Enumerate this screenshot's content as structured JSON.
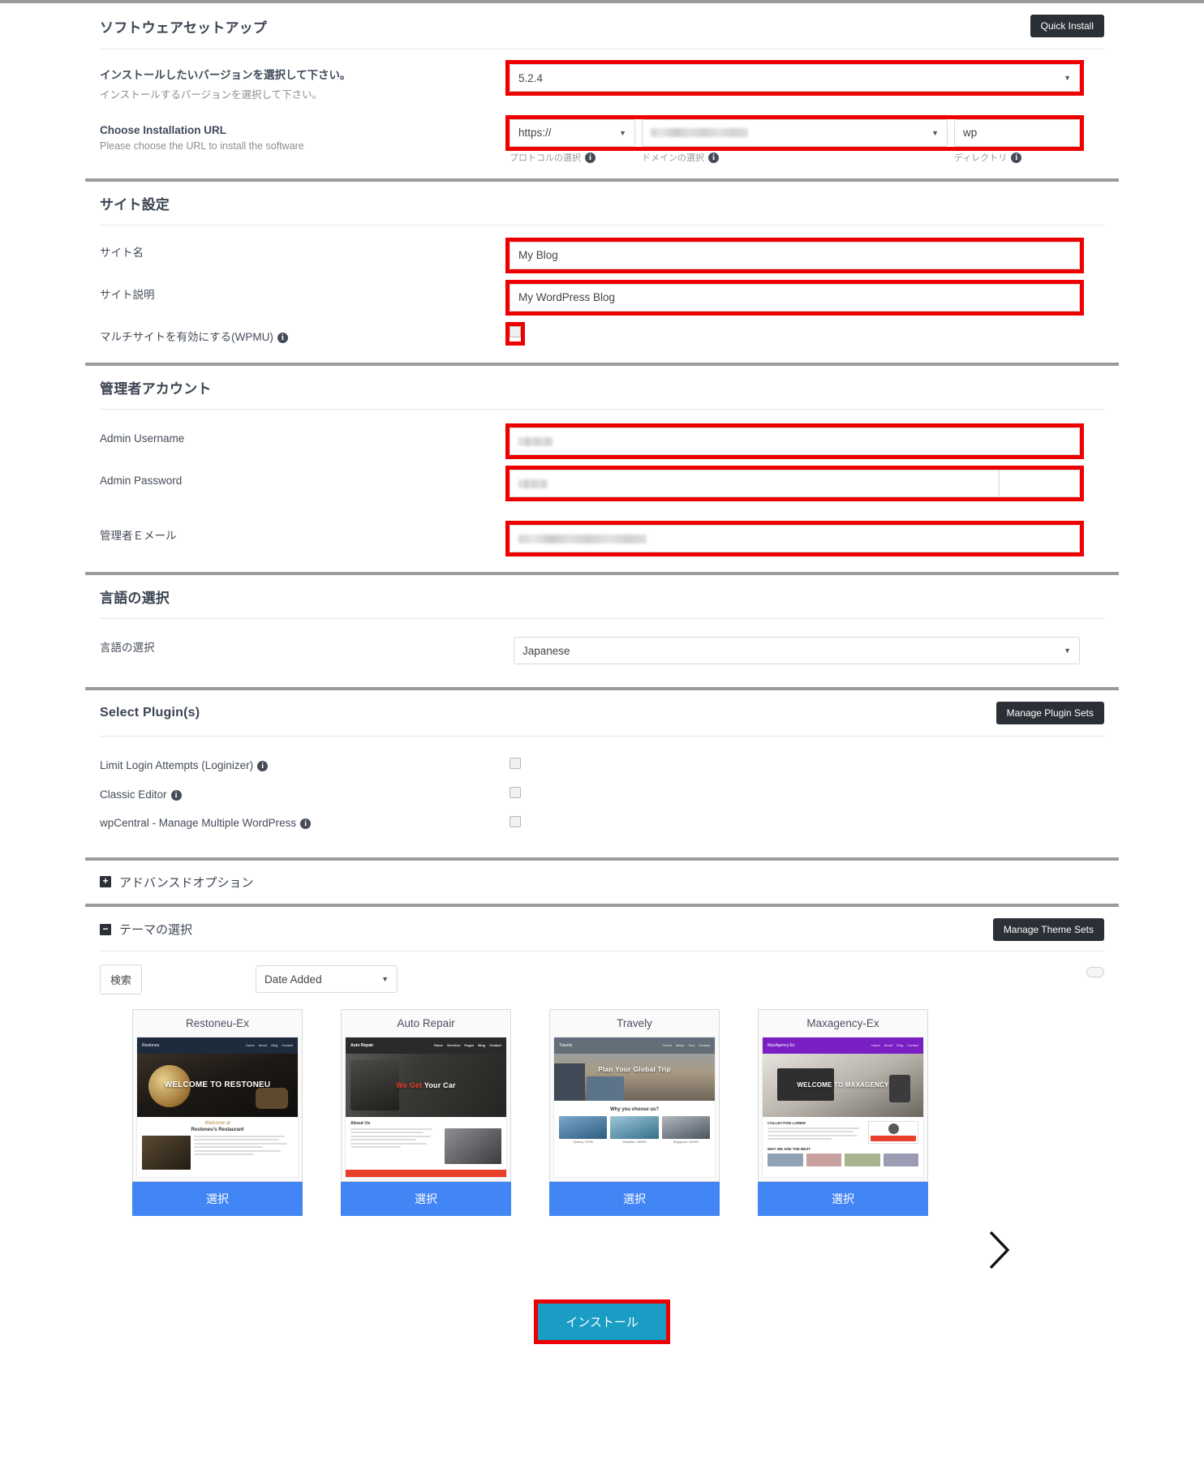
{
  "software_setup": {
    "title": "ソフトウェアセットアップ",
    "quick_install_label": "Quick Install",
    "version": {
      "label": "インストールしたいバージョンを選択して下さい。",
      "sublabel": "インストールするバージョンを選択して下さい。",
      "value": "5.2.4"
    },
    "install_url": {
      "label": "Choose Installation URL",
      "sublabel": "Please choose the URL to install the software",
      "protocol_value": "https://",
      "domain_value": "",
      "directory_value": "wp",
      "protocol_hint": "プロトコルの選択",
      "domain_hint": "ドメインの選択",
      "directory_hint": "ディレクトリ"
    }
  },
  "site_settings": {
    "title": "サイト設定",
    "site_name": {
      "label": "サイト名",
      "value": "My Blog"
    },
    "site_description": {
      "label": "サイト説明",
      "value": "My WordPress Blog"
    },
    "multisite": {
      "label": "マルチサイトを有効にする(WPMU)",
      "checked": false
    }
  },
  "admin_account": {
    "title": "管理者アカウント",
    "username": {
      "label": "Admin Username",
      "value": ""
    },
    "password": {
      "label": "Admin Password",
      "value": ""
    },
    "email": {
      "label": "管理者Ｅメール",
      "value": ""
    }
  },
  "language": {
    "title": "言語の選択",
    "field_label": "言語の選択",
    "value": "Japanese"
  },
  "plugins": {
    "title": "Select Plugin(s)",
    "manage_label": "Manage Plugin Sets",
    "items": [
      {
        "label": "Limit Login Attempts (Loginizer)",
        "checked": false
      },
      {
        "label": "Classic Editor",
        "checked": false
      },
      {
        "label": "wpCentral - Manage Multiple WordPress",
        "checked": false
      }
    ]
  },
  "advanced_options": {
    "label": "アドバンスドオプション",
    "toggle": "+"
  },
  "theme_selection": {
    "label": "テーマの選択",
    "toggle": "−",
    "manage_label": "Manage Theme Sets",
    "search_label": "検索",
    "sort_value": "Date Added",
    "select_label": "選択",
    "next_icon": "chevron-right-icon",
    "themes": [
      {
        "name": "Restoneu-Ex",
        "hero": "WELCOME TO RESTONEU",
        "brand": "Restoneu",
        "header_color": "#1e2b3c",
        "accent": "#c8a45c"
      },
      {
        "name": "Auto Repair",
        "hero": "We Get Your Car",
        "brand": "Auto Repair",
        "header_color": "#2a2a2a",
        "accent": "#e8402a"
      },
      {
        "name": "Travely",
        "hero": "Plan Your Global Trip",
        "brand": "Travely",
        "header_color": "#6d7e8c",
        "accent": "#2e9fd8"
      },
      {
        "name": "Maxagency-Ex",
        "hero": "WELCOME TO MAXAGENCY",
        "brand": "MaxAgency-Ex",
        "header_color": "#7a1fc4",
        "accent": "#7a1fc4"
      }
    ]
  },
  "install_button": {
    "label": "インストール"
  }
}
